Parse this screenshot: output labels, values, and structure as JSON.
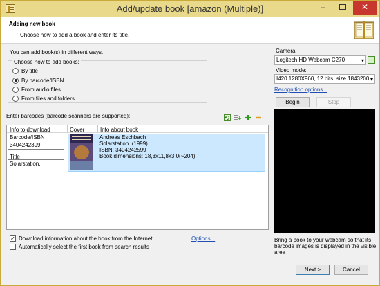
{
  "window": {
    "title": "Add/update book [amazon (Multiple)]",
    "minimize_glyph": "–",
    "close_glyph": "✕"
  },
  "header": {
    "title": "Adding new book",
    "subtitle": "Choose how to add a book and enter its title."
  },
  "intro": "You can add book(s) in different ways.",
  "choose_group": {
    "title": "Choose how to add books:",
    "options": [
      "By title",
      "By barcode/ISBN",
      "From audio files",
      "From files and folders"
    ],
    "selected": "By barcode/ISBN"
  },
  "barcodes": {
    "label": "Enter barcodes (barcode scanners are supported):"
  },
  "table": {
    "headers": {
      "download": "Info to download",
      "cover": "Cover",
      "info": "Info about book"
    },
    "barcode_label": "Barcode/ISBN",
    "barcode_value": "3404242399",
    "title_label": "Title",
    "title_value": "Solarstation.",
    "info_lines": [
      "Andreas Eschbach",
      "Solarstation. (1999)",
      "ISBN: 3404242599",
      "Book dimensions: 18,3x11,8x3,0(~204)"
    ]
  },
  "options_bottom": {
    "download_label": "Download information about the book from the Internet",
    "download_checked": true,
    "auto_select_label": "Automatically select the first book from search results",
    "auto_select_checked": false,
    "options_link": "Options..."
  },
  "camera_panel": {
    "camera_label": "Camera:",
    "camera_value": "Logitech HD Webcam C270",
    "video_mode_label": "Video mode:",
    "video_mode_value": "I420 1280X960, 12 bits, size 1843200",
    "recognition_link": "Recognition options...",
    "begin_label": "Begin",
    "stop_label": "Stop",
    "hint": "Bring a book to your webcam so that its barcode images is displayed in the visible area"
  },
  "footer": {
    "next_label": "Next >",
    "cancel_label": "Cancel"
  },
  "colors": {
    "title_bar": "#e9d98a",
    "close_button": "#c7372e",
    "selection": "#cce8ff",
    "link": "#1f4fb5"
  }
}
